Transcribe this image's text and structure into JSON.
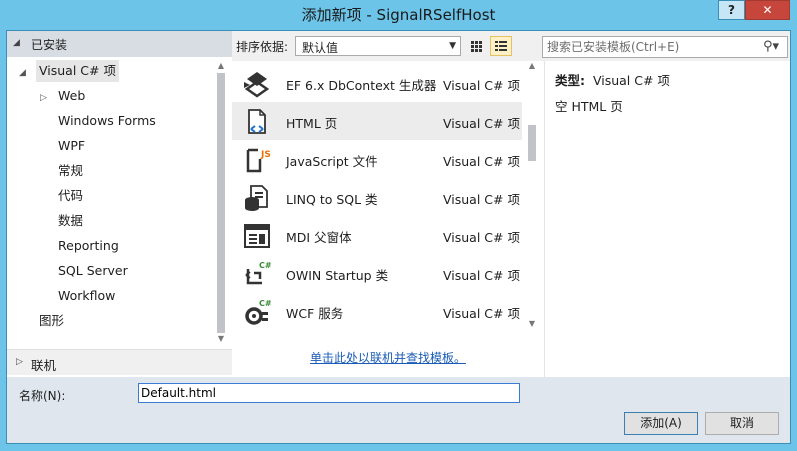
{
  "window": {
    "title": "添加新项 - SignalRSelfHost",
    "help": "?",
    "close": "✕"
  },
  "left": {
    "installed": "已安装",
    "tree": [
      {
        "label": "Visual C# 项",
        "expander": "◢"
      },
      {
        "label": "Web",
        "expander": "▷"
      },
      {
        "label": "Windows Forms"
      },
      {
        "label": "WPF"
      },
      {
        "label": "常规"
      },
      {
        "label": "代码"
      },
      {
        "label": "数据"
      },
      {
        "label": "Reporting"
      },
      {
        "label": "SQL Server"
      },
      {
        "label": "Workflow"
      },
      {
        "label": "图形"
      }
    ],
    "online": "联机"
  },
  "toolbar": {
    "sort_label": "排序依据:",
    "sort_value": "默认值",
    "search_placeholder": "搜索已安装模板(Ctrl+E)"
  },
  "templates": [
    {
      "name": "EF 6.x DbContext 生成器",
      "lang": "Visual C# 项",
      "icon": "ef-generator-icon"
    },
    {
      "name": "HTML 页",
      "lang": "Visual C# 项",
      "icon": "html-page-icon",
      "selected": true
    },
    {
      "name": "JavaScript 文件",
      "lang": "Visual C# 项",
      "icon": "javascript-file-icon"
    },
    {
      "name": "LINQ to SQL 类",
      "lang": "Visual C# 项",
      "icon": "linq-to-sql-icon"
    },
    {
      "name": "MDI 父窗体",
      "lang": "Visual C# 项",
      "icon": "mdi-form-icon"
    },
    {
      "name": "OWIN Startup 类",
      "lang": "Visual C# 项",
      "icon": "owin-startup-icon"
    },
    {
      "name": "WCF 服务",
      "lang": "Visual C# 项",
      "icon": "wcf-service-icon"
    }
  ],
  "online_link": "单击此处以联机并查找模板。",
  "detail": {
    "type_label": "类型:",
    "type_value": "Visual C# 项",
    "description": "空 HTML 页"
  },
  "bottom": {
    "name_label": "名称(N):",
    "name_value": "Default.html",
    "add": "添加(A)",
    "cancel": "取消"
  }
}
